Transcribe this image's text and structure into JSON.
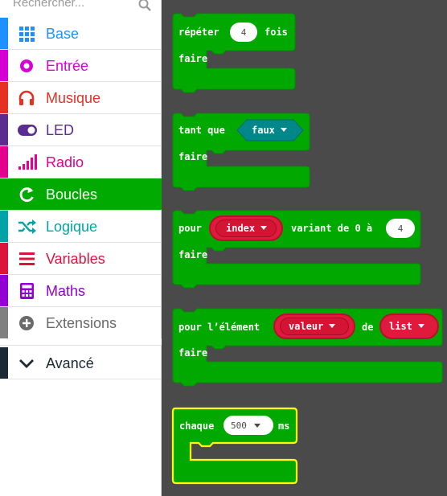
{
  "search": {
    "placeholder": "Rechercher..."
  },
  "categories": [
    {
      "label": "Base",
      "color": "#1e90ff",
      "icon": "grid-icon"
    },
    {
      "label": "Entrée",
      "color": "#d400d4",
      "icon": "input-circle-icon"
    },
    {
      "label": "Musique",
      "color": "#e63022",
      "icon": "headphones-icon"
    },
    {
      "label": "LED",
      "color": "#5c2d91",
      "icon": "toggle-icon"
    },
    {
      "label": "Radio",
      "color": "#e3008c",
      "icon": "signal-bars-icon"
    },
    {
      "label": "Boucles",
      "color": "#00aa00",
      "icon": "loop-arrow-icon",
      "active": true
    },
    {
      "label": "Logique",
      "color": "#00a4a6",
      "icon": "shuffle-icon"
    },
    {
      "label": "Variables",
      "color": "#dc143c",
      "icon": "list-lines-icon"
    },
    {
      "label": "Maths",
      "color": "#9400d3",
      "icon": "calculator-icon"
    },
    {
      "label": "Extensions",
      "color": "#808080",
      "icon": "plus-circle-icon"
    },
    {
      "label": "Avancé",
      "color": "#1b2a34",
      "icon": "chevron-down-icon"
    }
  ],
  "blocks": {
    "repeat": {
      "kw1": "répéter",
      "count": "4",
      "kw2": "fois",
      "body": "faire"
    },
    "while": {
      "kw1": "tant que",
      "cond": "faux",
      "body": "faire"
    },
    "for": {
      "kw1": "pour",
      "var": "index",
      "kw2": "variant de 0 à",
      "max": "4",
      "body": "faire"
    },
    "foreach": {
      "kw1": "pour l’élément",
      "var": "valeur",
      "kw2": "de",
      "list": "list",
      "body": "faire"
    },
    "every": {
      "kw1": "chaque",
      "interval": "500",
      "kw2": "ms"
    }
  },
  "colors": {
    "loops": "#00a800",
    "loops_dark": "#009000",
    "variable": "#e01a3c",
    "logic": "#00878a",
    "selected": "#ffff00"
  }
}
